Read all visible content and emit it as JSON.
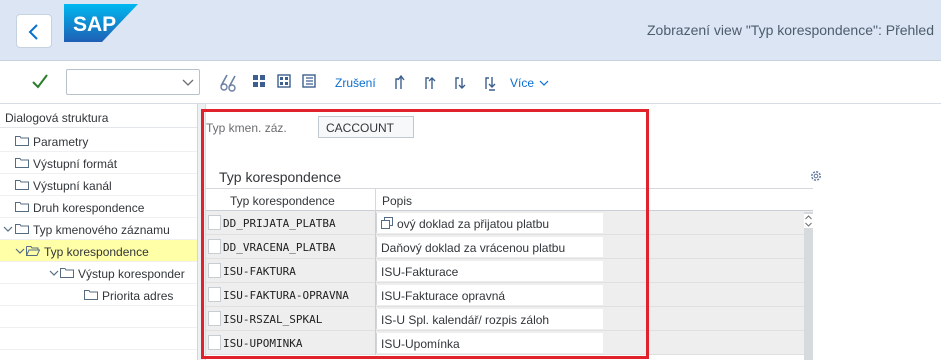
{
  "header": {
    "logo_text": "SAP",
    "title": "Zobrazení view \"Typ korespondence\": Přehled",
    "brand_color": "#0a6ed1"
  },
  "toolbar": {
    "command_value": "",
    "cancel_label": "Zrušení",
    "more_label": "Více",
    "icons": [
      "back-icon",
      "check-icon",
      "glasses-icon",
      "select-all-icon",
      "select-block-icon",
      "deselect-icon",
      "first-page-icon",
      "previous-page-icon",
      "next-page-icon",
      "last-page-icon"
    ]
  },
  "tree": {
    "heading": "Dialogová struktura",
    "items": [
      {
        "label": "Parametry"
      },
      {
        "label": "Výstupní formát"
      },
      {
        "label": "Výstupní kanál"
      },
      {
        "label": "Druh korespondence"
      },
      {
        "label": "Typ kmenového záznamu"
      },
      {
        "label": "Typ korespondence"
      },
      {
        "label": "Výstup koresponder"
      },
      {
        "label": "Priorita adres"
      }
    ],
    "selected_color": "#ffffa8"
  },
  "filter": {
    "label": "Typ kmen. záz.",
    "value": "CACCOUNT"
  },
  "section": {
    "title": "Typ korespondence"
  },
  "table": {
    "columns": [
      "Typ korespondence",
      "Popis"
    ],
    "rows": [
      {
        "key": "DD_PRIJATA_PLATBA",
        "desc": "ový doklad za přijatou platbu"
      },
      {
        "key": "DD_VRACENA_PLATBA",
        "desc": "Daňový doklad za vrácenou platbu"
      },
      {
        "key": "ISU-FAKTURA",
        "desc": "ISU-Fakturace"
      },
      {
        "key": "ISU-FAKTURA-OPRAVNA",
        "desc": "ISU-Fakturace opravná"
      },
      {
        "key": "ISU-RSZAL_SPKAL",
        "desc": "IS-U Spl. kalendář/ rozpis záloh"
      },
      {
        "key": "ISU-UPOMINKA",
        "desc": "ISU-Upomínka"
      }
    ]
  },
  "highlight_color": "#e0222a"
}
